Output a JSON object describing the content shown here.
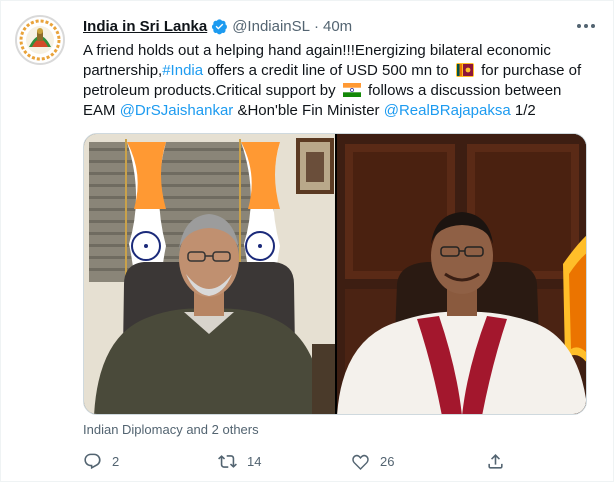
{
  "author": {
    "name": "India in Sri Lanka",
    "handle": "@IndiainSL",
    "separator": "·",
    "time": "40m"
  },
  "tweet": {
    "line1": "A friend holds out a helping hand again!!!Energizing bilateral economic",
    "line2_a": "partnership,",
    "line2_hashtag": "#India",
    "line2_b": " offers a credit line of USD 500 mn to ",
    "line2_c": " for purchase of",
    "line3_a": "petroleum products.Critical support by ",
    "line3_b": " follows a discussion between",
    "line4_a": "EAM ",
    "line4_mention1": "@DrSJaishankar",
    "line4_b": " &Hon'ble Fin Minister ",
    "line4_mention2": "@RealBRajapaksa",
    "line4_c": " 1/2"
  },
  "media_caption": "Indian Diplomacy and 2 others",
  "actions": {
    "replies": "2",
    "retweets": "14",
    "likes": "26"
  },
  "colors": {
    "link": "#1d9bf0",
    "text": "#0f1419",
    "muted": "#536471",
    "verified": "#1d9bf0",
    "saffron": "#ff9933",
    "india_green": "#138808",
    "chakra": "#000080",
    "sl_maroon": "#8d153a",
    "sl_gold": "#ffbe29"
  },
  "icons": [
    "verified-badge-icon",
    "more-icon",
    "reply-icon",
    "retweet-icon",
    "like-icon",
    "share-icon",
    "sri-lanka-flag-icon",
    "india-flag-icon"
  ]
}
